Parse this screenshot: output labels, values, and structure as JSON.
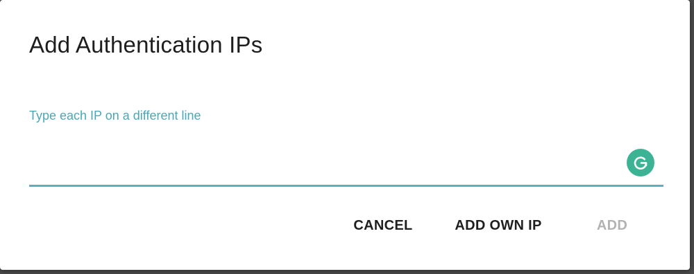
{
  "dialog": {
    "title": "Add Authentication IPs",
    "field": {
      "label": "Type each IP on a different line",
      "value": ""
    },
    "grammarly_icon": "grammarly-g-icon",
    "actions": {
      "cancel_label": "CANCEL",
      "add_own_ip_label": "ADD OWN IP",
      "add_label": "ADD"
    }
  },
  "colors": {
    "accent": "#4aa7b8",
    "underline": "#5bb0bd",
    "grammarly": "#3cb395",
    "disabled_text": "#b3b3b3",
    "text": "#1f1f1f"
  }
}
